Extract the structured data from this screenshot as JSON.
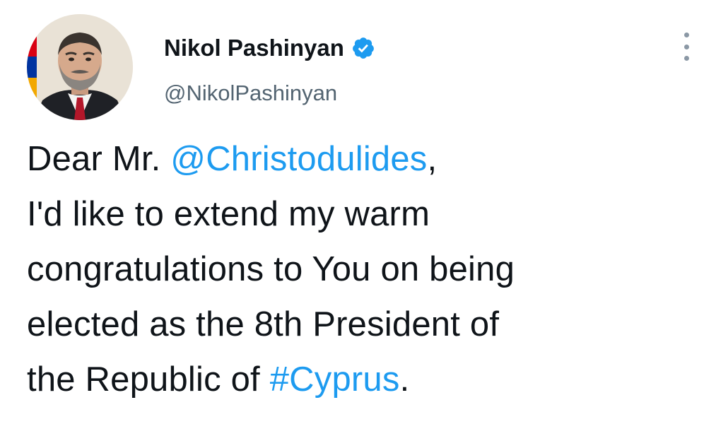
{
  "author": {
    "display_name": "Nikol Pashinyan",
    "handle": "@NikolPashinyan",
    "verified": true
  },
  "colors": {
    "link": "#1d9bf0",
    "text": "#0f1419",
    "muted": "#536471",
    "verified_badge": "#1d9bf0"
  },
  "icons": {
    "verified": "verified-badge-icon",
    "more": "more-options-icon"
  },
  "tweet": {
    "line1_prefix": "Dear Mr. ",
    "mention": "@Christodulides",
    "line1_suffix": ",",
    "line2": "I'd like to extend my warm",
    "line3": "congratulations to You on being",
    "line4": "elected as the 8th President of",
    "line5_prefix": "the Republic of ",
    "hashtag": "#Cyprus",
    "line5_suffix": "."
  }
}
